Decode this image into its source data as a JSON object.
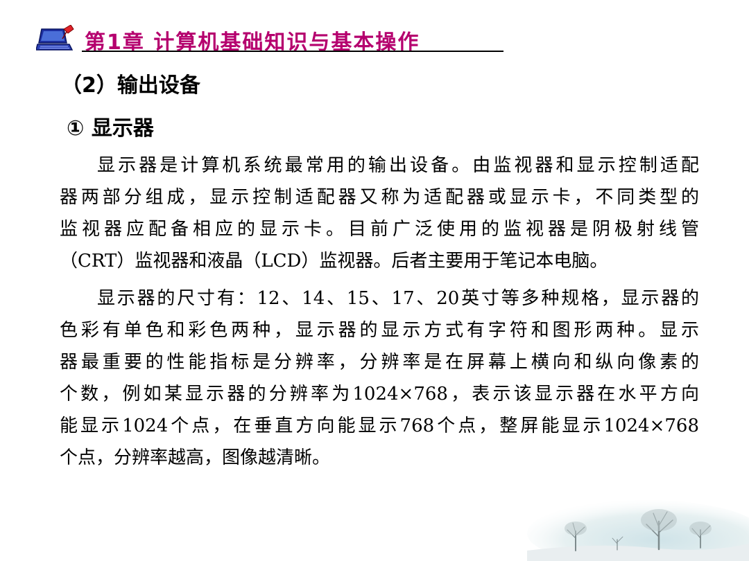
{
  "header": {
    "title": "第1章   计算机基础知识与基本操作",
    "logo_icon": "laptop-icon"
  },
  "section": {
    "heading": "（2）输出设备",
    "subheading": "① 显示器"
  },
  "paragraph1": {
    "lines": [
      "显示器是计算机系统最常用的输出设备。由监视器和显示控制适配",
      "器两部分组成，显示控制适配器又称为适配器或显示卡，不同类型的",
      "监视器应配备相应的显示卡。目前广泛使用的监视器是阴极射线管",
      "（CRT）监视器和液晶（LCD）监视器。后者主要用于笔记本电脑。"
    ]
  },
  "paragraph2": {
    "lines": [
      "显示器的尺寸有：12、14、15、17、20英寸等多种规格，显示器的",
      "色彩有单色和彩色两种，显示器的显示方式有字符和图形两种。显示",
      "器最重要的性能指标是分辨率，分辨率是在屏幕上横向和纵向像素的",
      "个数，例如某显示器的分辨率为1024×768，表示该显示器在水平方向",
      "能显示1024个点，在垂直方向能显示768个点，整屏能显示1024×768",
      "个点，分辨率越高，图像越清晰。"
    ]
  },
  "colors": {
    "title": "#b5006e",
    "text": "#000000"
  }
}
